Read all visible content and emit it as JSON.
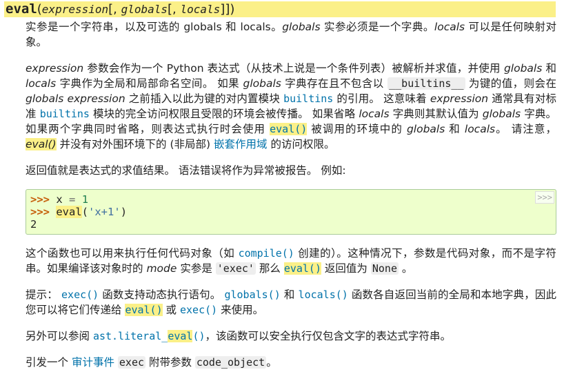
{
  "signature": {
    "name": "eval",
    "open": "(",
    "p1": "expression",
    "b1": "[, ",
    "p2": "globals",
    "b2": "[, ",
    "p3": "locals",
    "close": "]])"
  },
  "para1": {
    "t1": "实参是一个字符串，以及可选的 globals 和 locals。",
    "e1": "globals",
    "t2": " 实参必须是一个字典。",
    "e2": "locals",
    "t3": " 可以是任何映射对象。"
  },
  "para2": {
    "e1": "expression",
    "t1": " 参数会作为一个 Python 表达式（从技术上说是一个条件列表）被解析并求值，并使用 ",
    "e2": "globals",
    "t2": " 和 ",
    "e3": "locals",
    "t3": " 字典作为全局和局部命名空间。 如果 ",
    "e4": "globals",
    "t4": " 字典存在且不包含以 ",
    "c1": "__builtins__",
    "t5": " 为键的值，则会在 ",
    "e5": "globals",
    "t6": " ",
    "e6": "expression",
    "t7": " 之前插入以此为键的对内置模块 ",
    "l1": "builtins",
    "t8": " 的引用。 这意味着 ",
    "e7": "expression",
    "t9": " 通常具有对标准 ",
    "l2": "builtins",
    "t10": " 模块的完全访问权限且受限的环境会被传播。 如果省略 ",
    "e8": "locals",
    "t11": " 字典则其默认值为 ",
    "e9": "globals",
    "t12": " 字典。 如果两个字典同时省略，则表达式执行时会使用 ",
    "l3": "eval()",
    "t13": " 被调用的环境中的 ",
    "e10": "globals",
    "t14": " 和 ",
    "e11": "locals",
    "t15": "。 请注意，",
    "e12": "eval()",
    "t16": " 并没有对外围环境下的 (非局部) ",
    "l4": "嵌套作用域",
    "t17": " 的访问权限。"
  },
  "para3": "返回值就是表达式的求值结果。 语法错误将作为异常被报告。 例如:",
  "code": {
    "prompt": ">>>",
    "l1_var": "x",
    "l1_op": "=",
    "l1_num": "1",
    "l2_fn": "eval",
    "l2_open": "(",
    "l2_str": "'x+1'",
    "l2_close": ")",
    "l3_out": "2",
    "copy": ">>>"
  },
  "para4": {
    "t1": "这个函数也可以用来执行任何代码对象（如 ",
    "l1": "compile()",
    "t2": " 创建的）。这种情况下，参数是代码对象，而不是字符串。如果编译该对象时的 ",
    "e1": "mode",
    "t3": " 实参是 ",
    "c1": "'exec'",
    "t4": " 那么 ",
    "l2": "eval()",
    "t5": " 返回值为 ",
    "c2": "None",
    "t6": " 。"
  },
  "para5": {
    "t1": "提示： ",
    "l1": "exec()",
    "t2": " 函数支持动态执行语句。 ",
    "l2": "globals()",
    "t3": " 和 ",
    "l3": "locals()",
    "t4": " 函数各自返回当前的全局和本地字典，因此您可以将它们传递给 ",
    "l4": "eval()",
    "t5": " 或 ",
    "l5": "exec()",
    "t6": " 来使用。"
  },
  "para6": {
    "t1": "另外可以参阅 ",
    "l1a": "ast.literal_",
    "l1b": "eval",
    "l1c": "()",
    "t2": "，该函数可以安全执行仅包含文字的表达式字符串。"
  },
  "para7": {
    "t1": "引发一个 ",
    "l1": "审计事件",
    "t2": " ",
    "c1": "exec",
    "t3": " 附带参数 ",
    "c2": "code_object",
    "t4": "。"
  }
}
